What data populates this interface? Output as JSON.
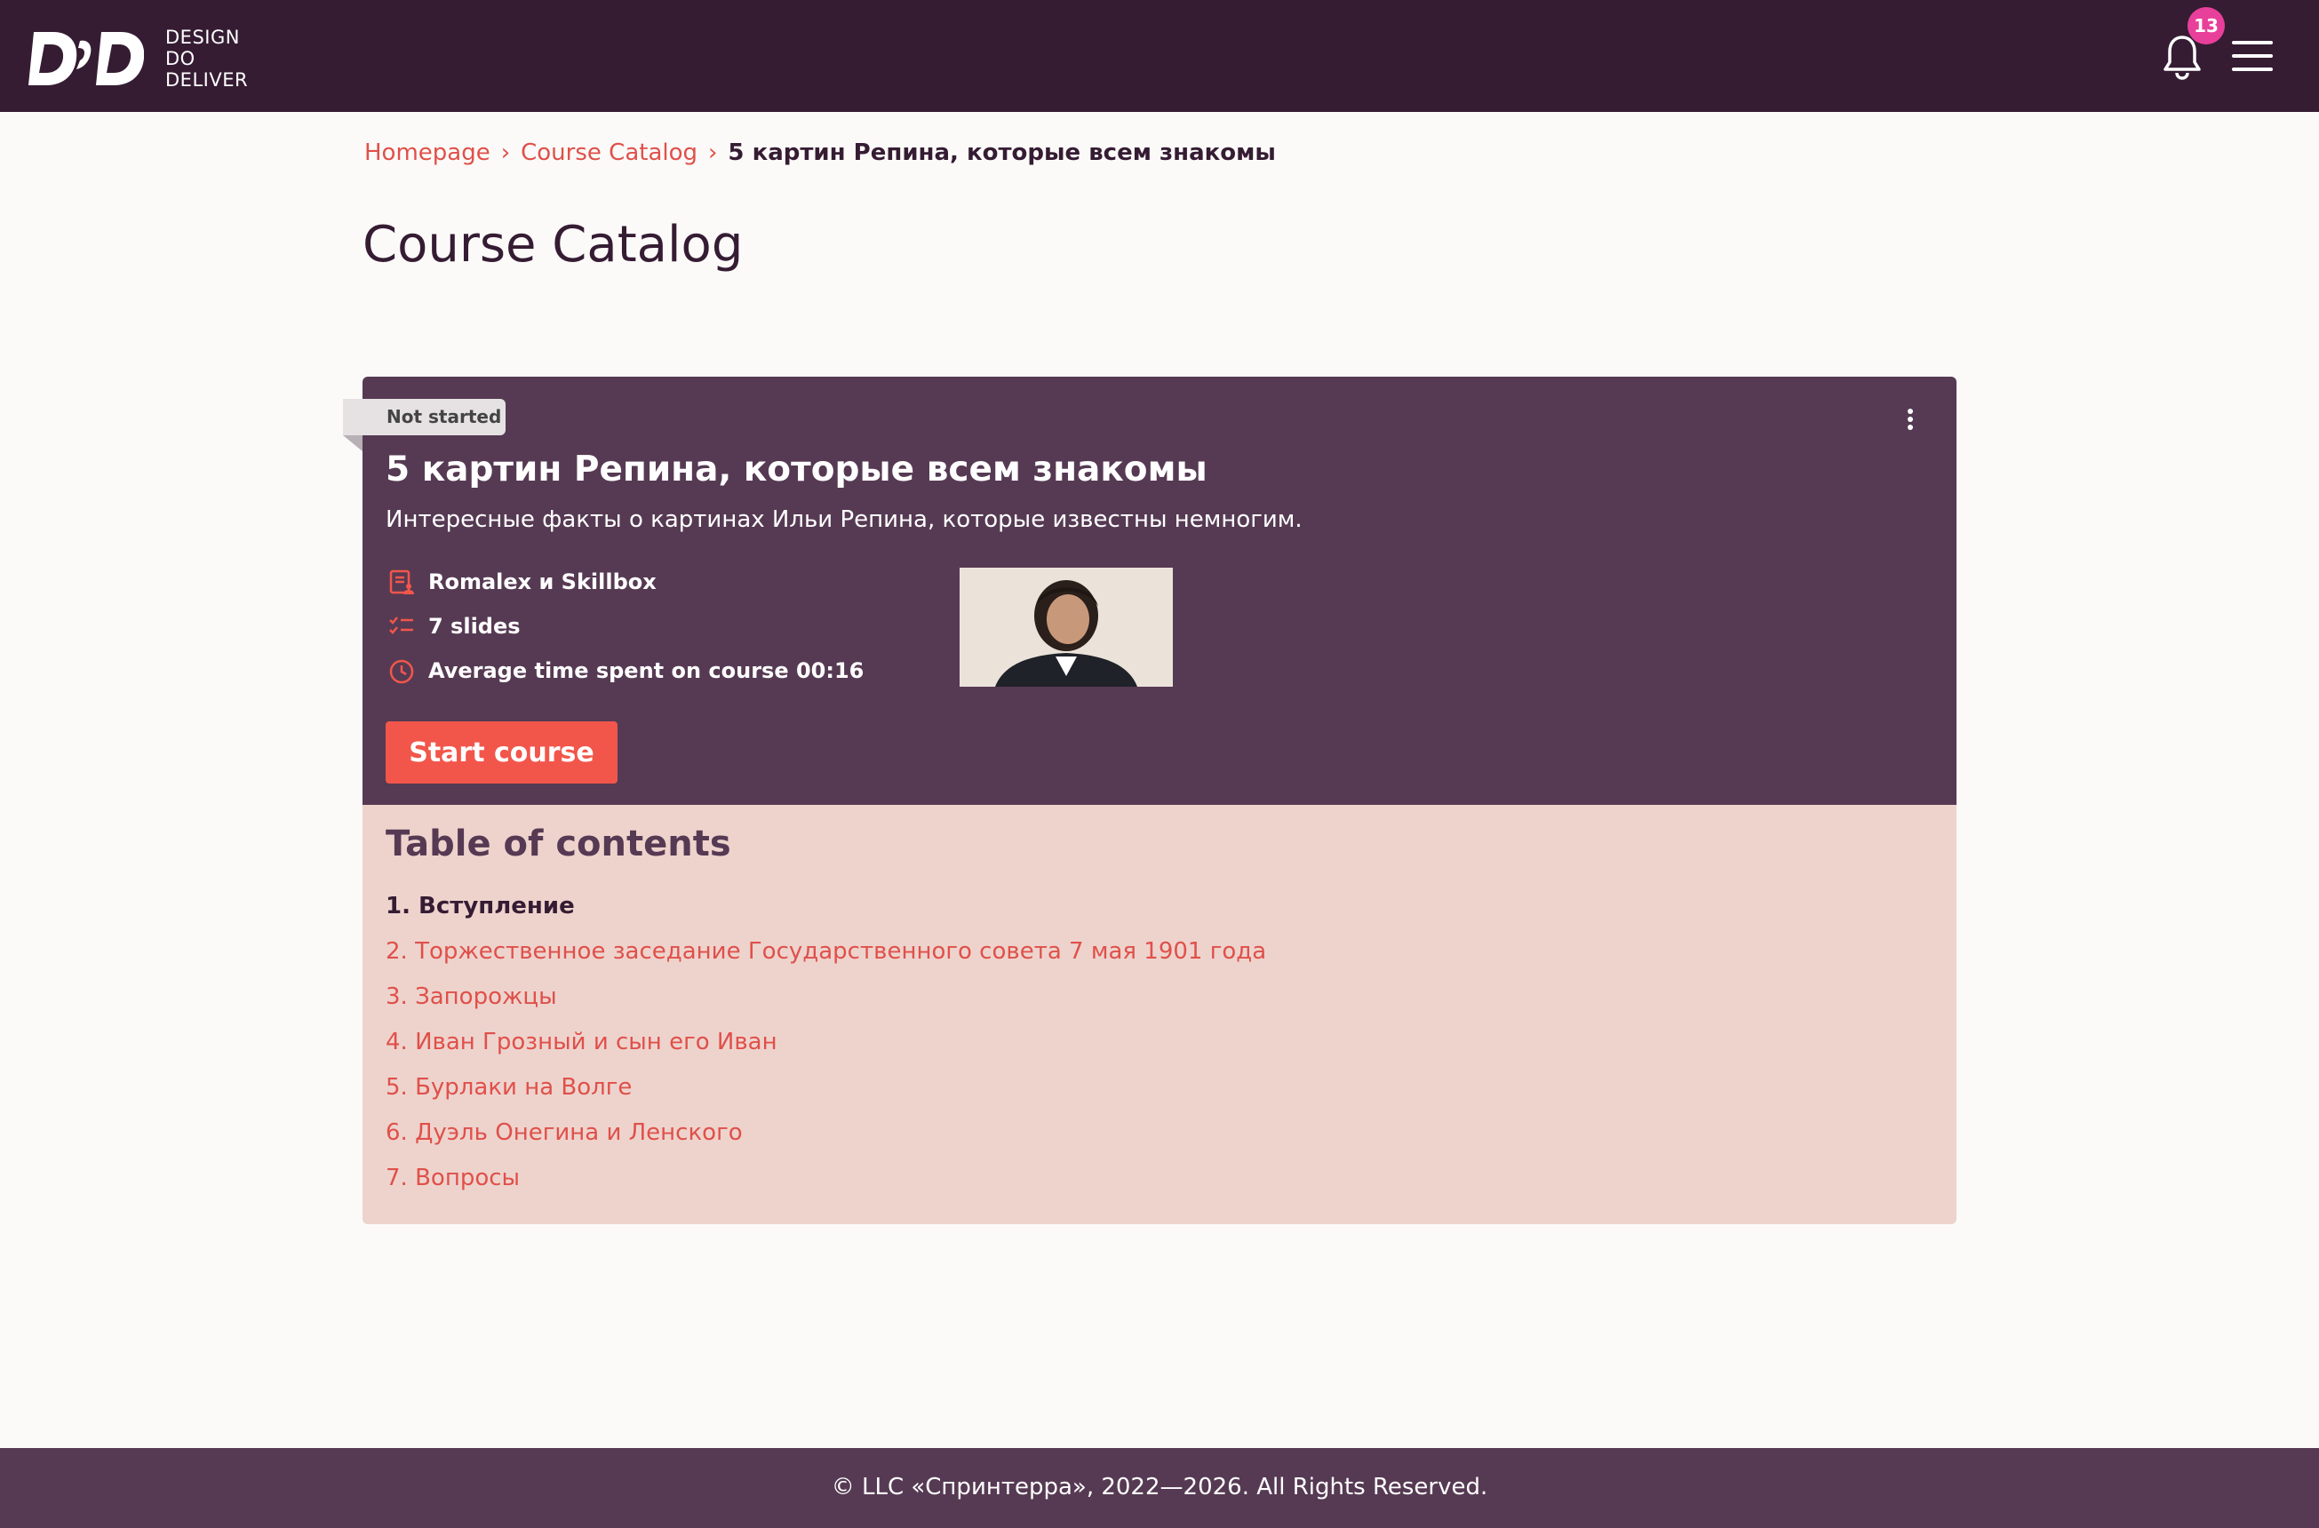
{
  "header": {
    "logo_lines": [
      "DESIGN",
      "DO",
      "DELIVER"
    ],
    "notifications_count": "13"
  },
  "breadcrumb": {
    "items": [
      "Homepage",
      "Course Catalog"
    ],
    "current": "5 картин Репина, которые всем знакомы",
    "separator": "›"
  },
  "page_title": "Course Catalog",
  "course": {
    "status": "Not started",
    "title": "5 картин Репина, которые всем знакомы",
    "description": "Интересные факты о картинах Ильи Репина, которые известны немногим.",
    "author": "Romalex и Skillbox",
    "slides": "7 slides",
    "avg_time": "Average time spent on course 00:16",
    "start_label": "Start course"
  },
  "toc": {
    "title": "Table of contents",
    "items": [
      "1. Вступление",
      "2. Торжественное заседание Государственного совета 7 мая 1901 года",
      "3. Запорожцы",
      "4. Иван Грозный и сын его Иван",
      "5. Бурлаки на Волге",
      "6. Дуэль Онегина и Ленского",
      "7. Вопросы"
    ]
  },
  "footer": {
    "text": "© LLC «Спринтерра», 2022—2026. All Rights Reserved."
  },
  "colors": {
    "header_bg": "#351c33",
    "card_bg": "#563a53",
    "toc_bg": "#eed3cd",
    "accent": "#f2564b",
    "link": "#e0504a",
    "badge": "#e8409a"
  }
}
